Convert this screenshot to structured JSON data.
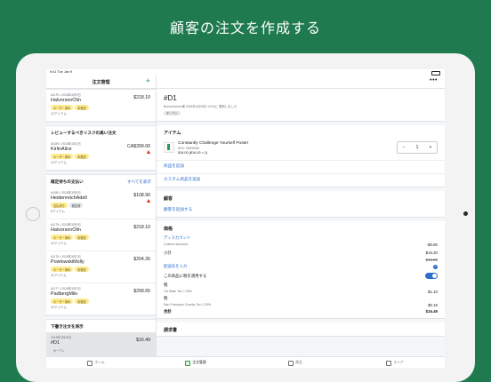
{
  "headline": "顧客の注文を作成する",
  "status_bar": {
    "time": "9:41 Tue Jan 9"
  },
  "left_nav": {
    "title": "注文管理",
    "add": "+"
  },
  "orders_top": [
    {
      "meta": "#1179 • 2018年3月5日",
      "customer": "HalvorsonOlin",
      "price": "$218.10",
      "badges": [
        "オーダー済み",
        "未発送"
      ],
      "count": "12アイテム"
    }
  ],
  "risk_section": {
    "title": "レビューするべきリスクの高い注文",
    "orders": [
      {
        "meta": "#1169 • 2018年3月1日",
        "customer": "KirlinAlice",
        "price": "CA$399.00",
        "badges": [
          "オーダー済み",
          "未発送"
        ],
        "count": "13アイテム"
      }
    ]
  },
  "pending_section": {
    "title": "確定待ちの支払い",
    "link": "すべてを表示",
    "orders": [
      {
        "meta": "#1180 • 2018年3月5日",
        "customer": "HeidenreichAdell",
        "price": "$108.90",
        "badges": [
          "支払待ち",
          "発送済"
        ],
        "count": "6アイテム"
      },
      {
        "meta": "#1179 • 2018年3月5日",
        "customer": "HalvorsonOlin",
        "price": "$218.10",
        "badges": [
          "オーダー済み",
          "未発送"
        ],
        "count": "12アイテム"
      },
      {
        "meta": "#1178 • 2018年3月2日",
        "customer": "PowlowskiMolly",
        "price": "$204.35",
        "badges": [
          "オーダー済み",
          "未発送"
        ],
        "count": "11アイテム"
      },
      {
        "meta": "#1177 • 2018年3月2日",
        "customer": "PadbergMilo",
        "price": "$299.65",
        "badges": [
          "オーダー済み",
          "未発送"
        ],
        "count": "12アイテム"
      }
    ]
  },
  "drafts_section": {
    "title": "下書き注文を表示",
    "orders": [
      {
        "meta": "2018年3月28日",
        "customer": "#D1",
        "price": "$16.49",
        "badges": [
          "オープン"
        ]
      }
    ]
  },
  "detail": {
    "menu": "•••",
    "order_id": "#D1",
    "subtitle": "BrownCarson様 2018年3月28日 13:16に 更新しました",
    "status": "オープン",
    "items_title": "アイテム",
    "item": {
      "name": "Constantly Challenge Yourself Poster",
      "sku": "SKU: 30000066",
      "price": "$16.00 ($16.00 × 1)",
      "qty": "1",
      "minus": "−",
      "plus": "+"
    },
    "add_product": "商品を追加",
    "add_custom": "カスタム商品を追加",
    "customer_title": "顧客",
    "add_customer": "顧客を追加する",
    "price_title": "価格",
    "discount_label": "ディスカウント",
    "discount_sub": "Custom discount",
    "discount_value": "-$0.80",
    "subtotal_label": "小計",
    "subtotal_value": "$15.20",
    "subtotal_original": "$16.00",
    "shipping_link": "配送先を入力",
    "tax_toggle_label": "この商品に税を適用する",
    "tax_label": "税",
    "tax1_name": "CA State Tax 7.25%",
    "tax1_value": "$1.10",
    "tax2_label": "税",
    "tax2_name": "San Francisco County Tax 1.25%",
    "tax2_value": "$0.19",
    "total_label": "合計",
    "total_value": "$16.49",
    "invoice_title": "請求書"
  },
  "tabs": [
    {
      "label": "ホーム",
      "icon": "home-icon"
    },
    {
      "label": "注文管理",
      "icon": "orders-icon"
    },
    {
      "label": "商品",
      "icon": "tag-icon"
    },
    {
      "label": "ストア",
      "icon": "store-icon"
    }
  ],
  "colors": {
    "background": "#1f7a4f",
    "accent": "#2b9c4f",
    "link": "#2c6ecb",
    "risk": "#d82c0d"
  }
}
